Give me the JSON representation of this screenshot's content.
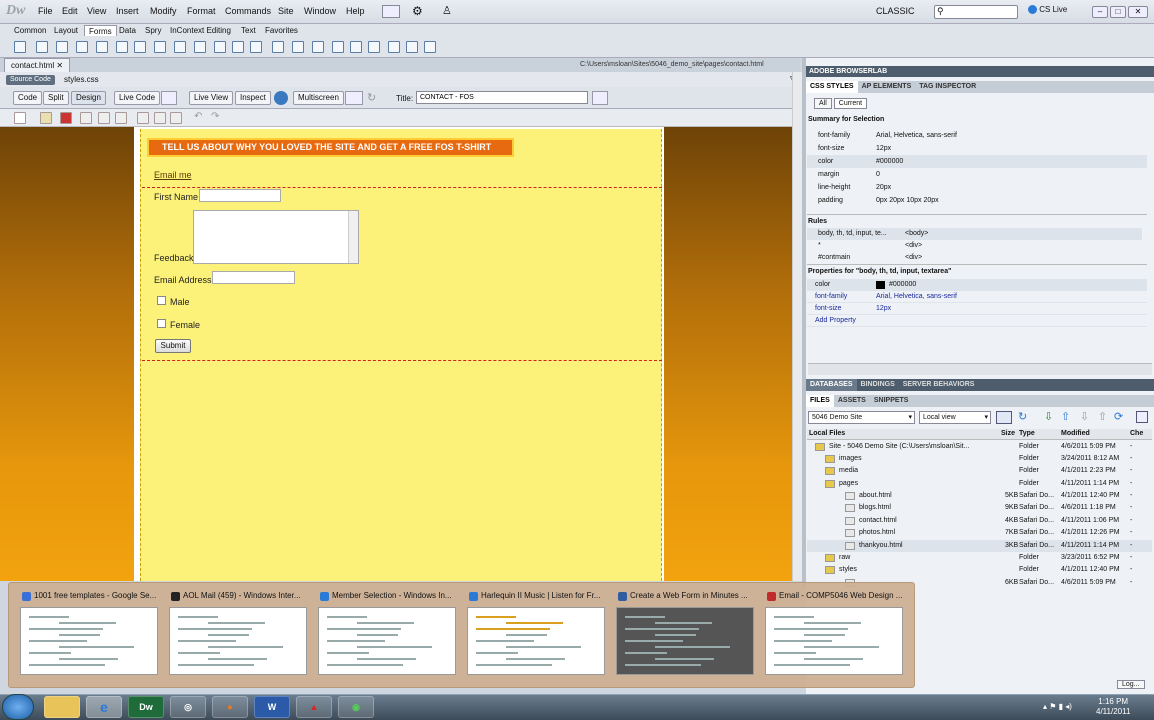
{
  "app": {
    "logo": "Dw",
    "workspace": "CLASSIC",
    "cs_live": "CS Live"
  },
  "menu": [
    "File",
    "Edit",
    "View",
    "Insert",
    "Modify",
    "Format",
    "Commands",
    "Site",
    "Window",
    "Help"
  ],
  "insert_tabs": [
    "Common",
    "Layout",
    "Forms",
    "Data",
    "Spry",
    "InContext Editing",
    "Text",
    "Favorites"
  ],
  "doc": {
    "tab": "contact.html",
    "path": "C:\\Users\\msloan\\Sites\\5046_demo_site\\pages\\contact.html",
    "source_code": "Source Code",
    "related_file": "styles.css",
    "view_buttons": [
      "Code",
      "Split",
      "Design",
      "Live Code",
      "Live View",
      "Inspect",
      "Multiscreen"
    ],
    "title_label": "Title:",
    "title_value": "CONTACT - FOS"
  },
  "page": {
    "banner": "TELL US ABOUT WHY YOU LOVED THE SITE AND GET A FREE FOS T-SHIRT",
    "email_link": "Email me",
    "first_name": "First Name",
    "feedback": "Feedback",
    "email_address": "Email Address",
    "male": "Male",
    "female": "Female",
    "submit": "Submit"
  },
  "panels": {
    "browserlab": "ADOBE BROWSERLAB",
    "css_tabs": [
      "CSS STYLES",
      "AP ELEMENTS",
      "TAG INSPECTOR"
    ],
    "all": "All",
    "current": "Current",
    "summary_title": "Summary for Selection",
    "summary": [
      {
        "k": "font-family",
        "v": "Arial, Helvetica, sans-serif"
      },
      {
        "k": "font-size",
        "v": "12px"
      },
      {
        "k": "color",
        "v": "#000000"
      },
      {
        "k": "margin",
        "v": "0"
      },
      {
        "k": "line-height",
        "v": "20px"
      },
      {
        "k": "padding",
        "v": "0px 20px 10px 20px"
      }
    ],
    "rules_title": "Rules",
    "rules": [
      {
        "k": "body, th, td, input, te...",
        "v": "<body>"
      },
      {
        "k": "*",
        "v": "<div>"
      },
      {
        "k": "#contmain",
        "v": "<div>"
      }
    ],
    "props_title": "Properties for \"body, th, td, input, textarea\"",
    "props": [
      {
        "k": "color",
        "v": "#000000"
      },
      {
        "k": "font-family",
        "v": "Arial, Helvetica, sans-serif"
      },
      {
        "k": "font-size",
        "v": "12px"
      },
      {
        "k": "Add Property",
        "v": ""
      }
    ],
    "db_tabs": [
      "DATABASES",
      "BINDINGS",
      "SERVER BEHAVIORS"
    ],
    "files_tabs": [
      "FILES",
      "ASSETS",
      "SNIPPETS"
    ],
    "site_select": "5046 Demo Site",
    "view_select": "Local view",
    "file_columns": [
      "Local Files",
      "Size",
      "Type",
      "Modified",
      "Che"
    ],
    "files": [
      {
        "name": "Site - 5046 Demo Site (C:\\Users\\msloan\\Sit...",
        "size": "",
        "type": "Folder",
        "modified": "4/6/2011 5:09 PM",
        "chk": "-"
      },
      {
        "name": "images",
        "size": "",
        "type": "Folder",
        "modified": "3/24/2011 8:12 AM",
        "chk": "-"
      },
      {
        "name": "media",
        "size": "",
        "type": "Folder",
        "modified": "4/1/2011 2:23 PM",
        "chk": "-"
      },
      {
        "name": "pages",
        "size": "",
        "type": "Folder",
        "modified": "4/11/2011 1:14 PM",
        "chk": "-"
      },
      {
        "name": "about.html",
        "size": "5KB",
        "type": "Safari Do...",
        "modified": "4/1/2011 12:40 PM",
        "chk": "-"
      },
      {
        "name": "blogs.html",
        "size": "9KB",
        "type": "Safari Do...",
        "modified": "4/6/2011 1:18 PM",
        "chk": "-"
      },
      {
        "name": "contact.html",
        "size": "4KB",
        "type": "Safari Do...",
        "modified": "4/11/2011 1:06 PM",
        "chk": "-"
      },
      {
        "name": "photos.html",
        "size": "7KB",
        "type": "Safari Do...",
        "modified": "4/1/2011 12:26 PM",
        "chk": "-"
      },
      {
        "name": "thankyou.html",
        "size": "3KB",
        "type": "Safari Do...",
        "modified": "4/11/2011 1:14 PM",
        "chk": "-"
      },
      {
        "name": "raw",
        "size": "",
        "type": "Folder",
        "modified": "3/23/2011 6:52 PM",
        "chk": "-"
      },
      {
        "name": "styles",
        "size": "",
        "type": "Folder",
        "modified": "4/1/2011 12:40 PM",
        "chk": "-"
      },
      {
        "name": "",
        "size": "6KB",
        "type": "Safari Do...",
        "modified": "4/6/2011 5:09 PM",
        "chk": "-"
      }
    ],
    "log": "Log..."
  },
  "previews": [
    {
      "title": "1001 free templates - Google Se...",
      "icon_color": "#3b6fd8"
    },
    {
      "title": "AOL Mail (459) - Windows Inter...",
      "icon_color": "#222222"
    },
    {
      "title": "Member Selection - Windows In...",
      "icon_color": "#2a7ad8"
    },
    {
      "title": "Harlequin II Music | Listen for Fr...",
      "icon_color": "#2a7ad8"
    },
    {
      "title": "Create a Web Form in Minutes ...",
      "icon_color": "#2f5ea0"
    },
    {
      "title": "Email - COMP5046 Web Design ...",
      "icon_color": "#c02b2b"
    }
  ],
  "taskbar": {
    "apps": [
      "ie",
      "explorer",
      "Dw",
      "firefox",
      "W",
      "pdf",
      "app"
    ],
    "dw_label": "Dw",
    "word_label": "W",
    "time": "1:16 PM",
    "date": "4/11/2011"
  },
  "colors": {
    "banner_bg": "#e86a10",
    "content_bg": "#fcf27a",
    "panel_header": "#4e5d6d"
  }
}
